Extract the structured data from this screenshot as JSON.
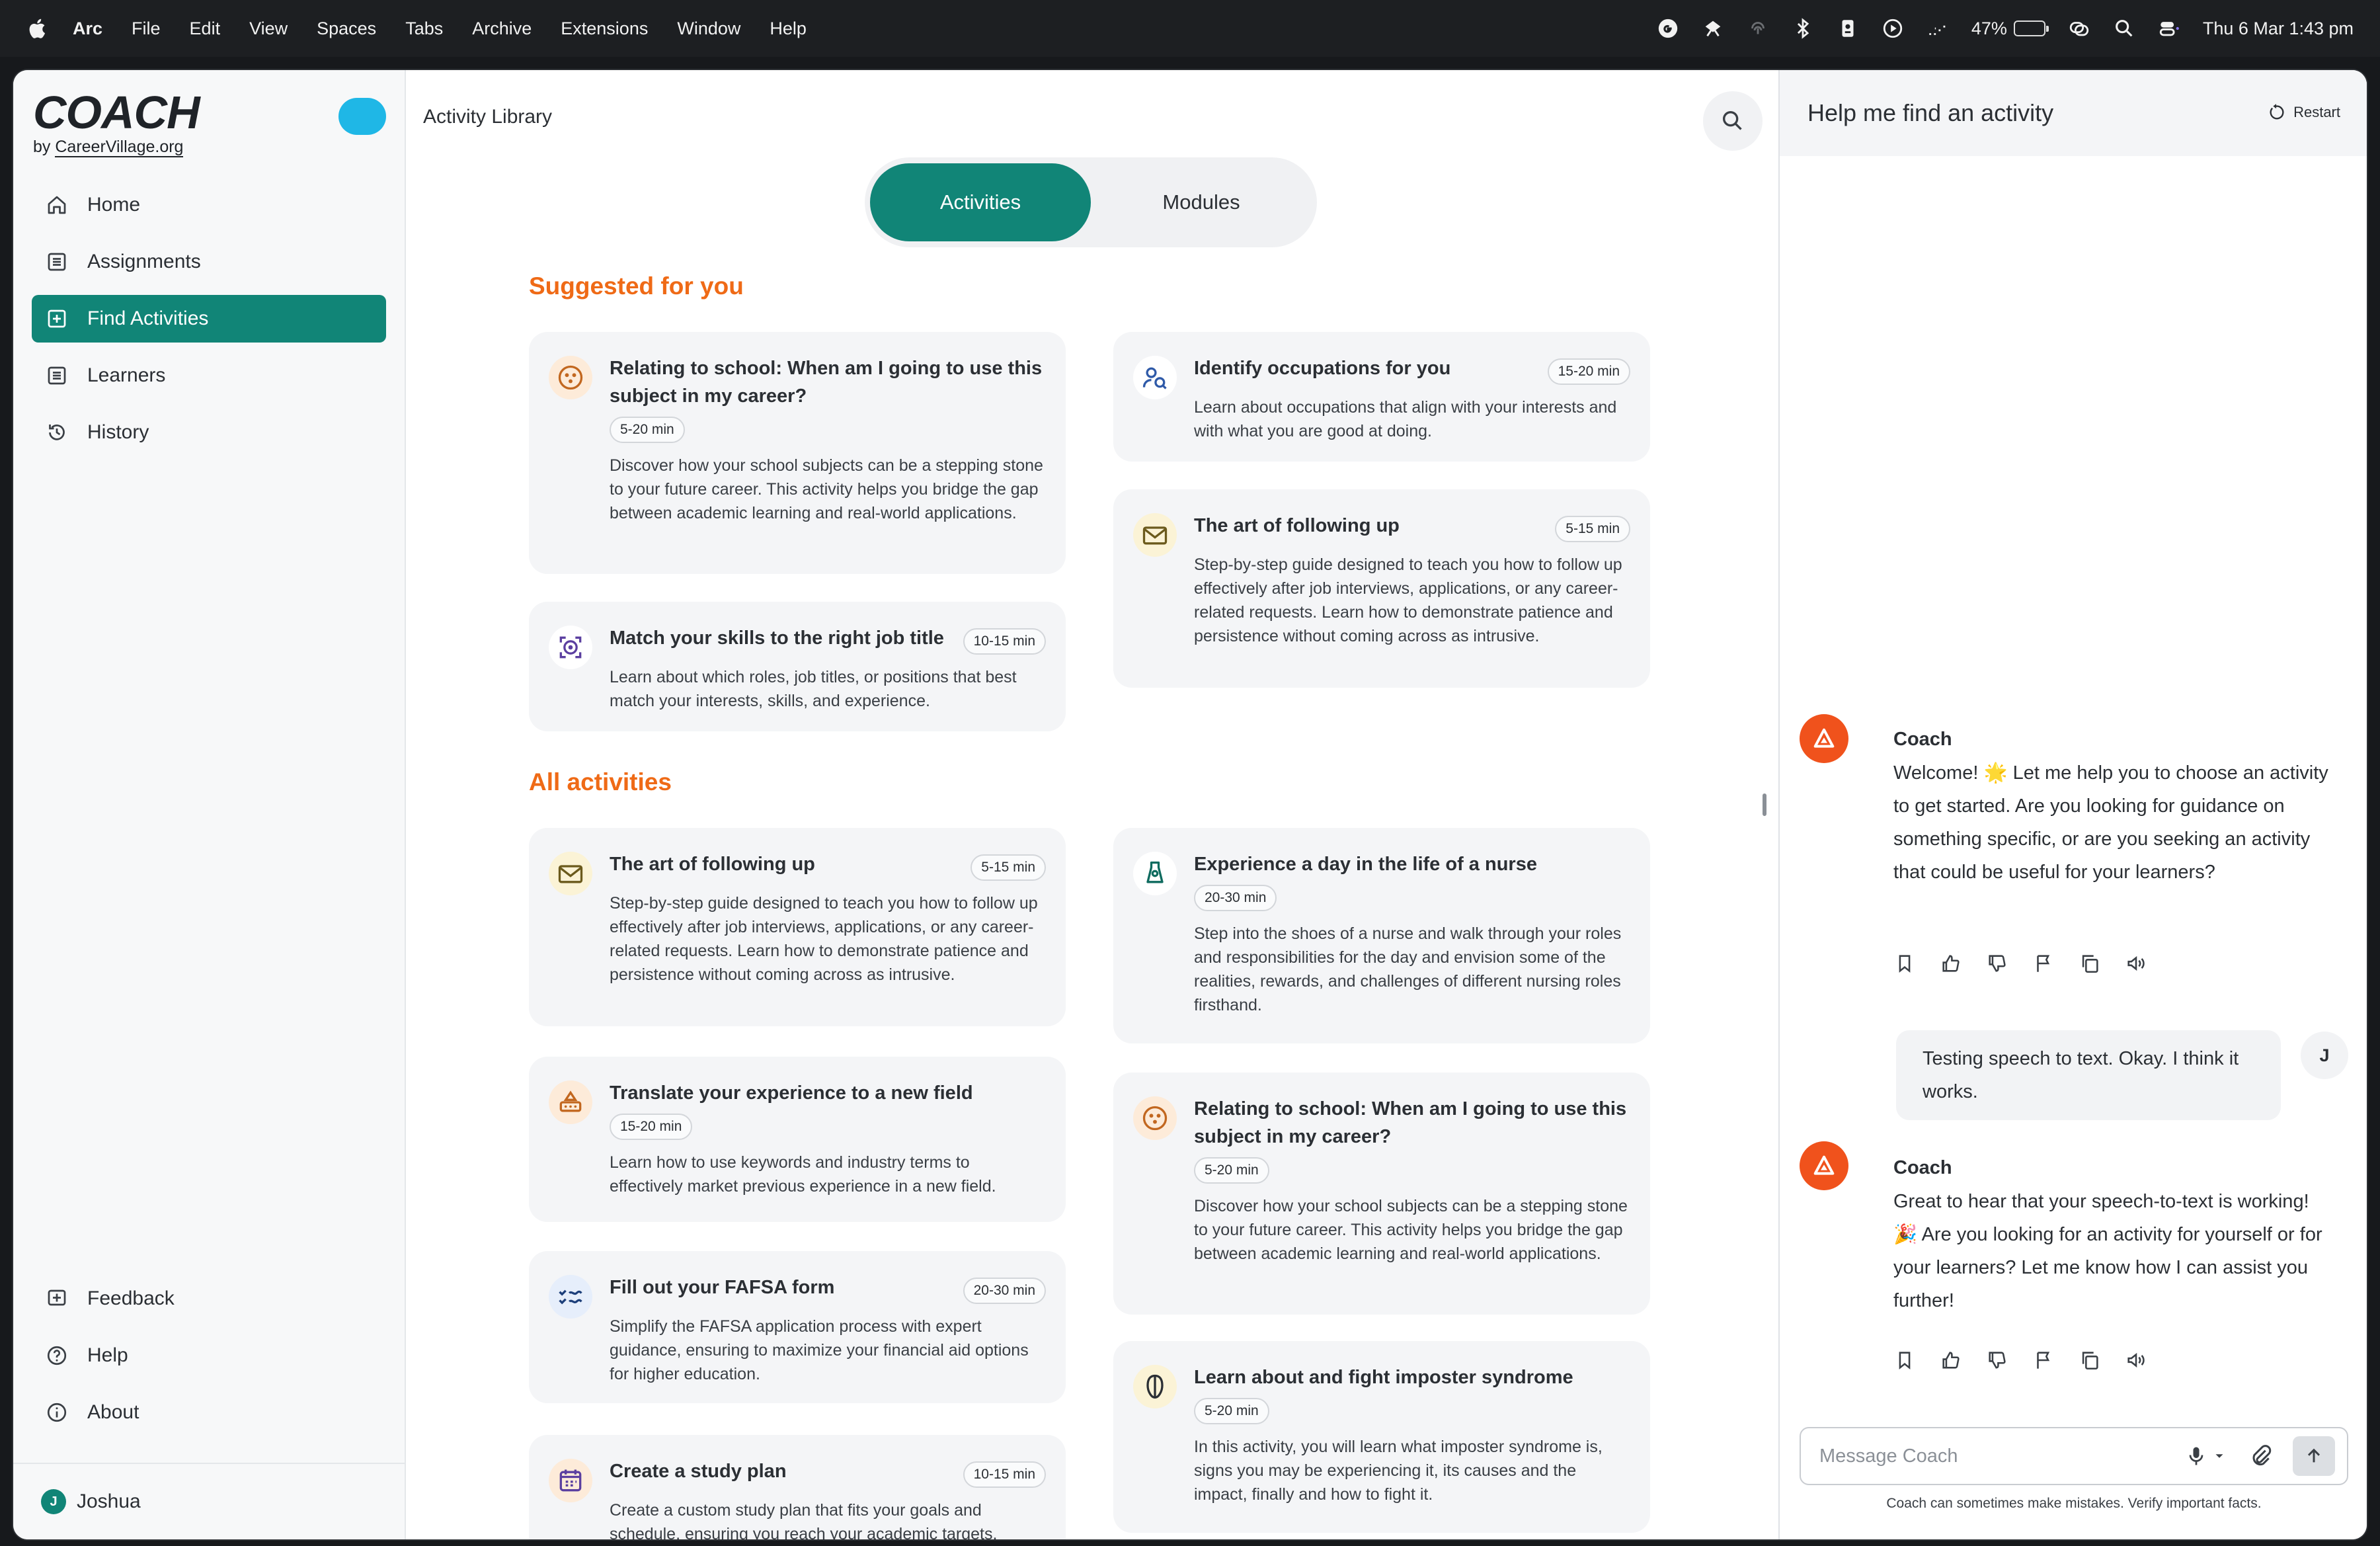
{
  "menubar": {
    "app": "Arc",
    "items": [
      "File",
      "Edit",
      "View",
      "Spaces",
      "Tabs",
      "Archive",
      "Extensions",
      "Window",
      "Help"
    ],
    "battery": "47%",
    "battery_level": 0.47,
    "clock": "Thu 6 Mar  1:43 pm"
  },
  "sidebar": {
    "logo": "COACH",
    "byline_prefix": "by ",
    "byline_brand": "CareerVillage.org",
    "nav": [
      {
        "label": "Home",
        "icon": "home-icon"
      },
      {
        "label": "Assignments",
        "icon": "list-icon"
      },
      {
        "label": "Find Activities",
        "icon": "plus-square-icon",
        "active": true
      },
      {
        "label": "Learners",
        "icon": "list-icon"
      },
      {
        "label": "History",
        "icon": "history-icon"
      }
    ],
    "bottom_nav": [
      {
        "label": "Feedback",
        "icon": "feedback-icon"
      },
      {
        "label": "Help",
        "icon": "help-circle-icon"
      },
      {
        "label": "About",
        "icon": "info-icon"
      }
    ],
    "user": {
      "initial": "J",
      "name": "Joshua"
    }
  },
  "main": {
    "title": "Activity Library",
    "tabs": [
      "Activities",
      "Modules"
    ],
    "suggested_title": "Suggested for you",
    "all_title": "All activities",
    "suggested": [
      {
        "title": "Relating to school: When am I going to use this subject in my career?",
        "duration": "5-20 min",
        "desc": "Discover how your school subjects can be a stepping stone to your future career. This activity helps you bridge the gap between academic learning and real-world applications.",
        "icon": "school-icon"
      },
      {
        "title": "Identify occupations for you",
        "duration": "15-20 min",
        "desc": "Learn about occupations that align with your interests and with what you are good at doing.",
        "icon": "person-search-icon"
      },
      {
        "title": "Match your skills to the right job title",
        "duration": "10-15 min",
        "desc": "Learn about which roles, job titles, or positions that best match your interests, skills, and experience.",
        "icon": "skills-target-icon"
      },
      {
        "title": "The art of following up",
        "duration": "5-15 min",
        "desc": "Step-by-step guide designed to teach you how to follow up effectively after job interviews, applications, or any career-related requests. Learn how to demonstrate patience and persistence without coming across as intrusive.",
        "icon": "envelope-icon"
      }
    ],
    "all": [
      {
        "title": "The art of following up",
        "duration": "5-15 min",
        "desc": "Step-by-step guide designed to teach you how to follow up effectively after job interviews, applications, or any career-related requests. Learn how to demonstrate patience and persistence without coming across as intrusive.",
        "icon": "envelope-icon"
      },
      {
        "title": "Experience a day in the life of a nurse",
        "duration": "20-30 min",
        "desc": "Step into the shoes of a nurse and walk through your roles and responsibilities for the day and envision some of the realities, rewards, and challenges of different nursing roles firsthand.",
        "icon": "nurse-icon"
      },
      {
        "title": "Translate your experience to a new field",
        "duration": "15-20 min",
        "desc": "Learn how to use keywords and industry terms to effectively market previous experience in a new field.",
        "icon": "translate-icon"
      },
      {
        "title": "Relating to school: When am I going to use this subject in my career?",
        "duration": "5-20 min",
        "desc": "Discover how your school subjects can be a stepping stone to your future career. This activity helps you bridge the gap between academic learning and real-world applications.",
        "icon": "school-icon"
      },
      {
        "title": "Fill out your FAFSA form",
        "duration": "20-30 min",
        "desc": "Simplify the FAFSA application process with expert guidance, ensuring to maximize your financial aid options for higher education.",
        "icon": "checklist-icon"
      },
      {
        "title": "Learn about and fight imposter syndrome",
        "duration": "5-20 min",
        "desc": "In this activity, you will learn what imposter syndrome is, signs you may be experiencing it, its causes and the impact, finally and how to fight it.",
        "icon": "mask-icon"
      },
      {
        "title": "Create a study plan",
        "duration": "10-15 min",
        "desc": "Create a custom study plan that fits your goals and schedule, ensuring you reach your academic targets.",
        "icon": "calendar-icon"
      }
    ]
  },
  "chat": {
    "title": "Help me find an activity",
    "restart": "Restart",
    "coach_name": "Coach",
    "messages": [
      {
        "from": "coach",
        "text": "Welcome! 🌟 Let me help you to choose an activity to get started. Are you looking for guidance on something specific, or are you seeking an activity that could be useful for your learners?"
      },
      {
        "from": "user",
        "initial": "J",
        "text": "Testing speech to text. Okay. I think it works."
      },
      {
        "from": "coach",
        "text": "Great to hear that your speech-to-text is working! 🎉 Are you looking for an activity for yourself or for your learners? Let me know how I can assist you further!"
      }
    ],
    "composer_placeholder": "Message Coach",
    "disclaimer": "Coach can sometimes make mistakes. Verify important facts."
  }
}
